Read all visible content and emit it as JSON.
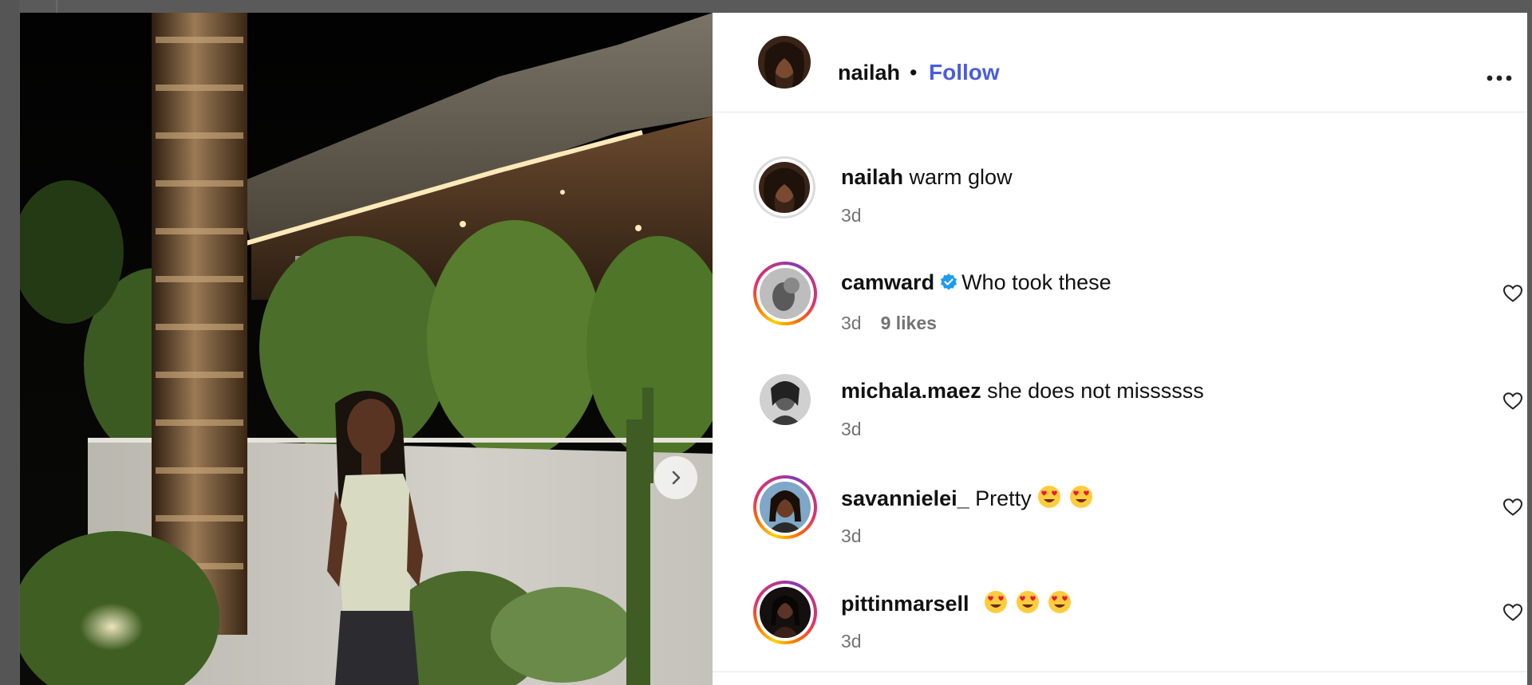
{
  "post": {
    "username": "nailah",
    "separator": "•",
    "follow_label": "Follow"
  },
  "comments": [
    {
      "username": "nailah",
      "text": "warm glow",
      "time": "3d",
      "likes": ""
    },
    {
      "username": "camward",
      "text": "Who took these",
      "time": "3d",
      "likes": "9 likes",
      "verified": true
    },
    {
      "username": "michala.maez",
      "text": "she does not missssss",
      "time": "3d",
      "likes": ""
    },
    {
      "username": "savannielei_",
      "text": "Pretty",
      "time": "3d",
      "likes": "",
      "emoji_count": 2
    },
    {
      "username": "pittinmarsell",
      "text": "",
      "time": "3d",
      "likes": "",
      "emoji_count": 3
    }
  ],
  "icons": {
    "more": "more-options-icon",
    "heart": "heart-outline-icon",
    "next": "chevron-right-icon",
    "verified": "verified-badge-icon",
    "emoji": "heart-eyes-emoji"
  },
  "colors": {
    "follow": "#4a5ce0",
    "verified": "#1d9bf0",
    "meta_text": "#737373"
  }
}
